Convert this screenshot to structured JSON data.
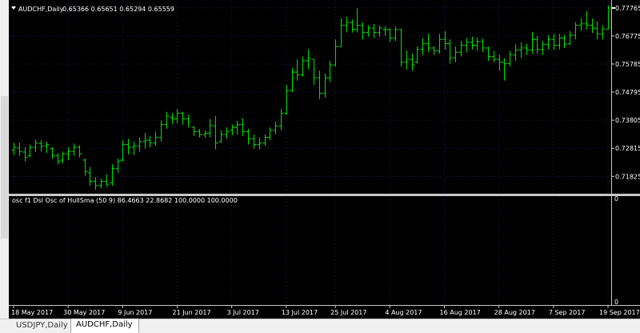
{
  "main_chart": {
    "symbol_label": "AUDCHF,Daily",
    "ohlc_label": "0.65366 0.65651 0.65294 0.65559",
    "price_axis": [
      "0.77765",
      "0.76775",
      "0.75785",
      "0.74795",
      "0.73805",
      "0.72815",
      "0.71825"
    ],
    "price_range": [
      0.7127,
      0.779
    ],
    "bar_color": "#00e000",
    "background": "#000000",
    "grid_color": "#1c1c4a"
  },
  "indicator": {
    "label": "osc f1 Dsl Osc of HullSma (50 9) 86.4663 22.8682 100.0000 100.0000",
    "axis_top": "0",
    "axis_bottom": "0"
  },
  "time_axis": [
    "18 May 2017",
    "30 May 2017",
    "9 Jun 2017",
    "21 Jun 2017",
    "3 Jul 2017",
    "13 Jul 2017",
    "25 Jul 2017",
    "4 Aug 2017",
    "16 Aug 2017",
    "28 Aug 2017",
    "7 Sep 2017",
    "19 Sep 2017"
  ],
  "tabs": [
    "USDJPY,Daily",
    "AUDCHF,Daily"
  ],
  "active_tab": "AUDCHF,Daily",
  "chart_data": {
    "type": "ohlc",
    "title": "AUDCHF,Daily",
    "ylim": [
      0.7127,
      0.779
    ],
    "bars": [
      {
        "h": 0.73,
        "l": 0.7258,
        "o": 0.7275,
        "c": 0.7285
      },
      {
        "h": 0.7302,
        "l": 0.7255,
        "o": 0.7282,
        "c": 0.727
      },
      {
        "h": 0.7285,
        "l": 0.7235,
        "o": 0.7268,
        "c": 0.725
      },
      {
        "h": 0.7295,
        "l": 0.725,
        "o": 0.7255,
        "c": 0.7285
      },
      {
        "h": 0.7312,
        "l": 0.7268,
        "o": 0.7285,
        "c": 0.73
      },
      {
        "h": 0.731,
        "l": 0.727,
        "o": 0.7298,
        "c": 0.7288
      },
      {
        "h": 0.7305,
        "l": 0.7265,
        "o": 0.729,
        "c": 0.7295
      },
      {
        "h": 0.7285,
        "l": 0.7245,
        "o": 0.728,
        "c": 0.7255
      },
      {
        "h": 0.7265,
        "l": 0.7225,
        "o": 0.7255,
        "c": 0.7235
      },
      {
        "h": 0.727,
        "l": 0.7228,
        "o": 0.724,
        "c": 0.7262
      },
      {
        "h": 0.7285,
        "l": 0.724,
        "o": 0.7262,
        "c": 0.727
      },
      {
        "h": 0.7298,
        "l": 0.7255,
        "o": 0.727,
        "c": 0.7285
      },
      {
        "h": 0.7292,
        "l": 0.725,
        "o": 0.7285,
        "c": 0.7262
      },
      {
        "h": 0.7245,
        "l": 0.7185,
        "o": 0.724,
        "c": 0.72
      },
      {
        "h": 0.7215,
        "l": 0.715,
        "o": 0.7195,
        "c": 0.7165
      },
      {
        "h": 0.718,
        "l": 0.7135,
        "o": 0.7165,
        "c": 0.715
      },
      {
        "h": 0.7175,
        "l": 0.714,
        "o": 0.715,
        "c": 0.7165
      },
      {
        "h": 0.719,
        "l": 0.7145,
        "o": 0.7165,
        "c": 0.7155
      },
      {
        "h": 0.7225,
        "l": 0.715,
        "o": 0.716,
        "c": 0.721
      },
      {
        "h": 0.7245,
        "l": 0.7195,
        "o": 0.721,
        "c": 0.7235
      },
      {
        "h": 0.731,
        "l": 0.7235,
        "o": 0.724,
        "c": 0.7295
      },
      {
        "h": 0.7315,
        "l": 0.726,
        "o": 0.7295,
        "c": 0.7285
      },
      {
        "h": 0.7305,
        "l": 0.7258,
        "o": 0.7285,
        "c": 0.729
      },
      {
        "h": 0.732,
        "l": 0.727,
        "o": 0.729,
        "c": 0.7305
      },
      {
        "h": 0.7335,
        "l": 0.728,
        "o": 0.7305,
        "c": 0.731
      },
      {
        "h": 0.7325,
        "l": 0.7285,
        "o": 0.731,
        "c": 0.73
      },
      {
        "h": 0.734,
        "l": 0.729,
        "o": 0.73,
        "c": 0.732
      },
      {
        "h": 0.738,
        "l": 0.7305,
        "o": 0.732,
        "c": 0.7365
      },
      {
        "h": 0.741,
        "l": 0.735,
        "o": 0.7365,
        "c": 0.7395
      },
      {
        "h": 0.7405,
        "l": 0.7368,
        "o": 0.739,
        "c": 0.7385
      },
      {
        "h": 0.742,
        "l": 0.737,
        "o": 0.7385,
        "c": 0.7405
      },
      {
        "h": 0.741,
        "l": 0.7365,
        "o": 0.7405,
        "c": 0.7385
      },
      {
        "h": 0.74,
        "l": 0.7355,
        "o": 0.7385,
        "c": 0.7375
      },
      {
        "h": 0.736,
        "l": 0.7325,
        "o": 0.7355,
        "c": 0.734
      },
      {
        "h": 0.735,
        "l": 0.732,
        "o": 0.734,
        "c": 0.733
      },
      {
        "h": 0.7345,
        "l": 0.7318,
        "o": 0.733,
        "c": 0.7335
      },
      {
        "h": 0.7385,
        "l": 0.732,
        "o": 0.7335,
        "c": 0.7362
      },
      {
        "h": 0.7395,
        "l": 0.7278,
        "o": 0.736,
        "c": 0.73
      },
      {
        "h": 0.7345,
        "l": 0.73,
        "o": 0.7305,
        "c": 0.733
      },
      {
        "h": 0.7355,
        "l": 0.7315,
        "o": 0.733,
        "c": 0.734
      },
      {
        "h": 0.7365,
        "l": 0.7328,
        "o": 0.7345,
        "c": 0.7355
      },
      {
        "h": 0.7378,
        "l": 0.733,
        "o": 0.7355,
        "c": 0.7365
      },
      {
        "h": 0.7388,
        "l": 0.7325,
        "o": 0.7365,
        "c": 0.734
      },
      {
        "h": 0.735,
        "l": 0.7295,
        "o": 0.734,
        "c": 0.7315
      },
      {
        "h": 0.733,
        "l": 0.728,
        "o": 0.7315,
        "c": 0.7295
      },
      {
        "h": 0.732,
        "l": 0.7278,
        "o": 0.7295,
        "c": 0.73
      },
      {
        "h": 0.733,
        "l": 0.729,
        "o": 0.73,
        "c": 0.732
      },
      {
        "h": 0.7355,
        "l": 0.731,
        "o": 0.732,
        "c": 0.7345
      },
      {
        "h": 0.7375,
        "l": 0.733,
        "o": 0.7345,
        "c": 0.736
      },
      {
        "h": 0.742,
        "l": 0.7345,
        "o": 0.736,
        "c": 0.7405
      },
      {
        "h": 0.7505,
        "l": 0.74,
        "o": 0.7405,
        "c": 0.7485
      },
      {
        "h": 0.7565,
        "l": 0.748,
        "o": 0.7485,
        "c": 0.755
      },
      {
        "h": 0.7595,
        "l": 0.752,
        "o": 0.755,
        "c": 0.754
      },
      {
        "h": 0.7605,
        "l": 0.7535,
        "o": 0.754,
        "c": 0.759
      },
      {
        "h": 0.763,
        "l": 0.756,
        "o": 0.759,
        "c": 0.76
      },
      {
        "h": 0.7595,
        "l": 0.7505,
        "o": 0.7595,
        "c": 0.753
      },
      {
        "h": 0.7555,
        "l": 0.7455,
        "o": 0.753,
        "c": 0.7475
      },
      {
        "h": 0.7545,
        "l": 0.746,
        "o": 0.7475,
        "c": 0.753
      },
      {
        "h": 0.759,
        "l": 0.7515,
        "o": 0.753,
        "c": 0.7575
      },
      {
        "h": 0.7665,
        "l": 0.757,
        "o": 0.7575,
        "c": 0.764
      },
      {
        "h": 0.774,
        "l": 0.764,
        "o": 0.764,
        "c": 0.7715
      },
      {
        "h": 0.7745,
        "l": 0.769,
        "o": 0.7715,
        "c": 0.7725
      },
      {
        "h": 0.7735,
        "l": 0.769,
        "o": 0.7725,
        "c": 0.77
      },
      {
        "h": 0.7775,
        "l": 0.769,
        "o": 0.77,
        "c": 0.7715
      },
      {
        "h": 0.7725,
        "l": 0.7665,
        "o": 0.7715,
        "c": 0.769
      },
      {
        "h": 0.7715,
        "l": 0.7675,
        "o": 0.769,
        "c": 0.7705
      },
      {
        "h": 0.772,
        "l": 0.767,
        "o": 0.7705,
        "c": 0.769
      },
      {
        "h": 0.7715,
        "l": 0.7675,
        "o": 0.769,
        "c": 0.7705
      },
      {
        "h": 0.7712,
        "l": 0.7678,
        "o": 0.77,
        "c": 0.77
      },
      {
        "h": 0.7705,
        "l": 0.7655,
        "o": 0.77,
        "c": 0.767
      },
      {
        "h": 0.771,
        "l": 0.766,
        "o": 0.767,
        "c": 0.77
      },
      {
        "h": 0.7702,
        "l": 0.757,
        "o": 0.77,
        "c": 0.7585
      },
      {
        "h": 0.7625,
        "l": 0.756,
        "o": 0.7585,
        "c": 0.7595
      },
      {
        "h": 0.7615,
        "l": 0.7555,
        "o": 0.7595,
        "c": 0.7575
      },
      {
        "h": 0.764,
        "l": 0.758,
        "o": 0.7585,
        "c": 0.763
      },
      {
        "h": 0.767,
        "l": 0.761,
        "o": 0.763,
        "c": 0.765
      },
      {
        "h": 0.7685,
        "l": 0.762,
        "o": 0.765,
        "c": 0.7635
      },
      {
        "h": 0.764,
        "l": 0.761,
        "o": 0.7635,
        "c": 0.7625
      },
      {
        "h": 0.7685,
        "l": 0.7615,
        "o": 0.7625,
        "c": 0.7665
      },
      {
        "h": 0.7695,
        "l": 0.763,
        "o": 0.7665,
        "c": 0.765
      },
      {
        "h": 0.7665,
        "l": 0.758,
        "o": 0.765,
        "c": 0.76
      },
      {
        "h": 0.764,
        "l": 0.7585,
        "o": 0.76,
        "c": 0.762
      },
      {
        "h": 0.766,
        "l": 0.7605,
        "o": 0.762,
        "c": 0.7645
      },
      {
        "h": 0.767,
        "l": 0.762,
        "o": 0.7645,
        "c": 0.7655
      },
      {
        "h": 0.7675,
        "l": 0.763,
        "o": 0.7655,
        "c": 0.7645
      },
      {
        "h": 0.7672,
        "l": 0.7625,
        "o": 0.7645,
        "c": 0.7658
      },
      {
        "h": 0.7668,
        "l": 0.762,
        "o": 0.7658,
        "c": 0.7635
      },
      {
        "h": 0.764,
        "l": 0.759,
        "o": 0.7635,
        "c": 0.7605
      },
      {
        "h": 0.7625,
        "l": 0.7585,
        "o": 0.7605,
        "c": 0.7595
      },
      {
        "h": 0.7612,
        "l": 0.7555,
        "o": 0.7595,
        "c": 0.7585
      },
      {
        "h": 0.7598,
        "l": 0.752,
        "o": 0.7585,
        "c": 0.758
      },
      {
        "h": 0.7625,
        "l": 0.757,
        "o": 0.758,
        "c": 0.7612
      },
      {
        "h": 0.7648,
        "l": 0.759,
        "o": 0.761,
        "c": 0.7628
      },
      {
        "h": 0.7655,
        "l": 0.76,
        "o": 0.7628,
        "c": 0.7635
      },
      {
        "h": 0.765,
        "l": 0.761,
        "o": 0.7635,
        "c": 0.7628
      },
      {
        "h": 0.7692,
        "l": 0.7615,
        "o": 0.7628,
        "c": 0.7665
      },
      {
        "h": 0.7678,
        "l": 0.7615,
        "o": 0.7665,
        "c": 0.763
      },
      {
        "h": 0.766,
        "l": 0.761,
        "o": 0.763,
        "c": 0.7648
      },
      {
        "h": 0.768,
        "l": 0.763,
        "o": 0.7648,
        "c": 0.7665
      },
      {
        "h": 0.7685,
        "l": 0.7628,
        "o": 0.7665,
        "c": 0.7645
      },
      {
        "h": 0.7685,
        "l": 0.763,
        "o": 0.7645,
        "c": 0.767
      },
      {
        "h": 0.7682,
        "l": 0.7635,
        "o": 0.767,
        "c": 0.7648
      },
      {
        "h": 0.7695,
        "l": 0.7645,
        "o": 0.765,
        "c": 0.768
      },
      {
        "h": 0.7725,
        "l": 0.7665,
        "o": 0.768,
        "c": 0.7715
      },
      {
        "h": 0.774,
        "l": 0.7695,
        "o": 0.7715,
        "c": 0.772
      },
      {
        "h": 0.7765,
        "l": 0.77,
        "o": 0.772,
        "c": 0.7715
      },
      {
        "h": 0.7738,
        "l": 0.7688,
        "o": 0.7715,
        "c": 0.7705
      },
      {
        "h": 0.7728,
        "l": 0.7665,
        "o": 0.7705,
        "c": 0.7685
      },
      {
        "h": 0.7715,
        "l": 0.7665,
        "o": 0.7685,
        "c": 0.7702
      },
      {
        "h": 0.7785,
        "l": 0.77,
        "o": 0.7702,
        "c": 0.7776
      }
    ]
  }
}
